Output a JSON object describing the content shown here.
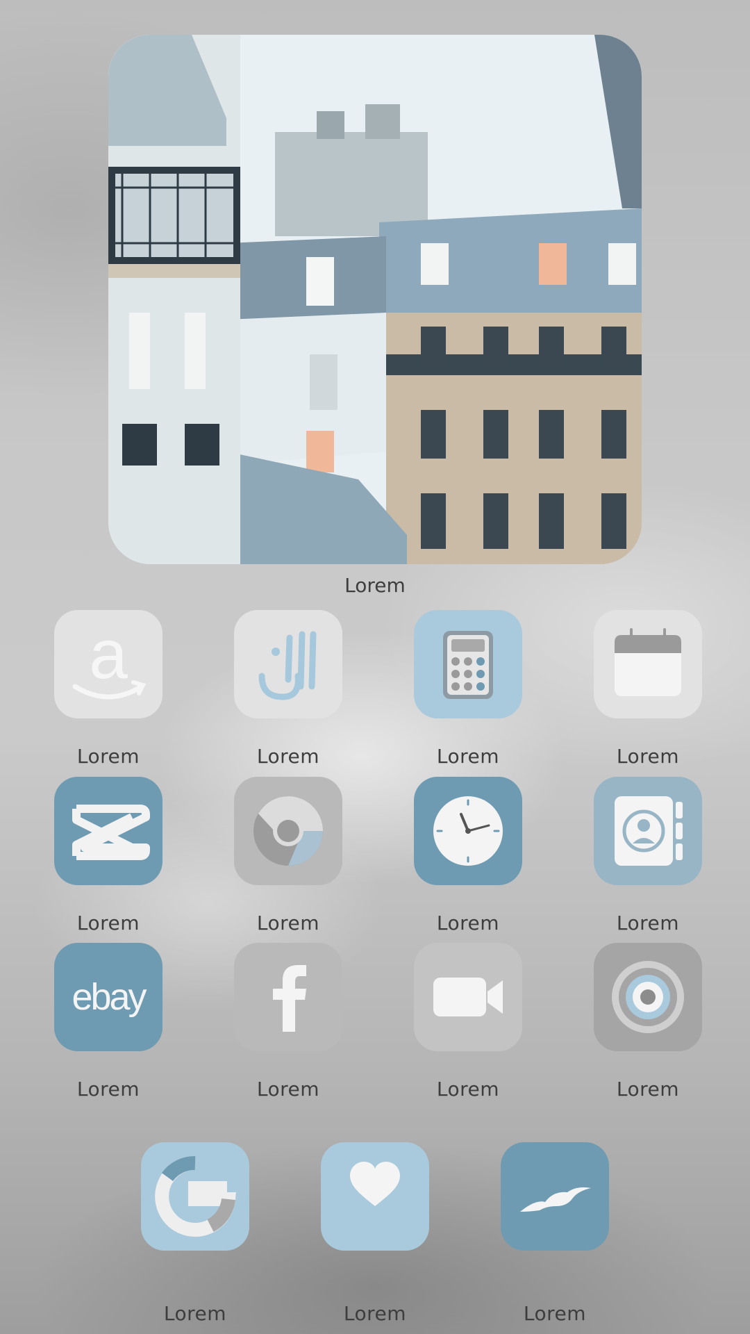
{
  "photo_widget": {
    "label": "Lorem"
  },
  "apps": [
    {
      "label": "Lorem",
      "icon": "amazon-icon",
      "tile_color": "#e2e2e2"
    },
    {
      "label": "Lorem",
      "icon": "arabic-calligraphy-icon",
      "tile_color": "#e2e2e2"
    },
    {
      "label": "Lorem",
      "icon": "calculator-icon",
      "tile_color": "#a9c9dc"
    },
    {
      "label": "Lorem",
      "icon": "calendar-icon",
      "tile_color": "#e2e2e2"
    },
    {
      "label": "Lorem",
      "icon": "capcut-icon",
      "tile_color": "#6e9bb2"
    },
    {
      "label": "Lorem",
      "icon": "chrome-icon",
      "tile_color": "#b9b9b9"
    },
    {
      "label": "Lorem",
      "icon": "clock-icon",
      "tile_color": "#6e9bb2"
    },
    {
      "label": "Lorem",
      "icon": "contacts-icon",
      "tile_color": "#98b5c6"
    },
    {
      "label": "Lorem",
      "icon": "ebay-icon",
      "tile_color": "#6e9bb2",
      "icon_text": "ebay"
    },
    {
      "label": "Lorem",
      "icon": "facebook-icon",
      "tile_color": "#b9b9b9"
    },
    {
      "label": "Lorem",
      "icon": "video-camera-icon",
      "tile_color": "#c3c3c3"
    },
    {
      "label": "Lorem",
      "icon": "camera-lens-icon",
      "tile_color": "#a5a5a5"
    }
  ],
  "dock": [
    {
      "label": "Lorem",
      "icon": "google-icon",
      "tile_color": "#a9c9dc"
    },
    {
      "label": "Lorem",
      "icon": "heart-icon",
      "tile_color": "#a9c9dc"
    },
    {
      "label": "Lorem",
      "icon": "seagull-icon",
      "tile_color": "#6e9bb2"
    }
  ]
}
